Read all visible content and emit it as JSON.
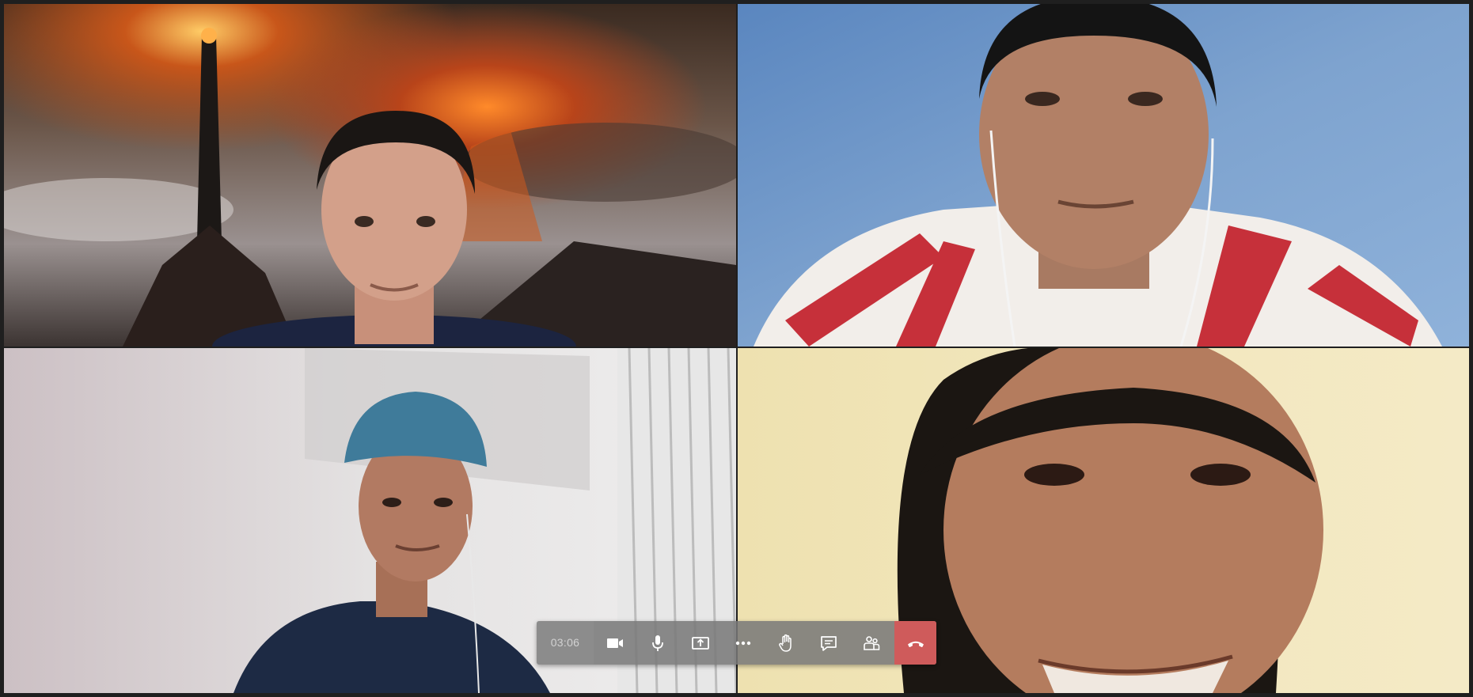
{
  "call": {
    "timer": "03:06",
    "controls": [
      {
        "name": "camera-icon"
      },
      {
        "name": "microphone-icon"
      },
      {
        "name": "share-screen-icon"
      },
      {
        "name": "more-options-icon"
      },
      {
        "name": "raise-hand-icon"
      },
      {
        "name": "chat-icon"
      },
      {
        "name": "participants-icon"
      },
      {
        "name": "hang-up-icon"
      }
    ],
    "colors": {
      "bar_bg": "#787878",
      "hangup": "#cf5b5b",
      "icon": "#ffffff"
    }
  },
  "participants": [
    {
      "tile": "video-tile-1",
      "background": "volcano-tower-scene"
    },
    {
      "tile": "video-tile-2",
      "background": "blue-wall"
    },
    {
      "tile": "video-tile-3",
      "background": "white-office-wall"
    },
    {
      "tile": "video-tile-4",
      "background": "yellow-wall"
    }
  ]
}
